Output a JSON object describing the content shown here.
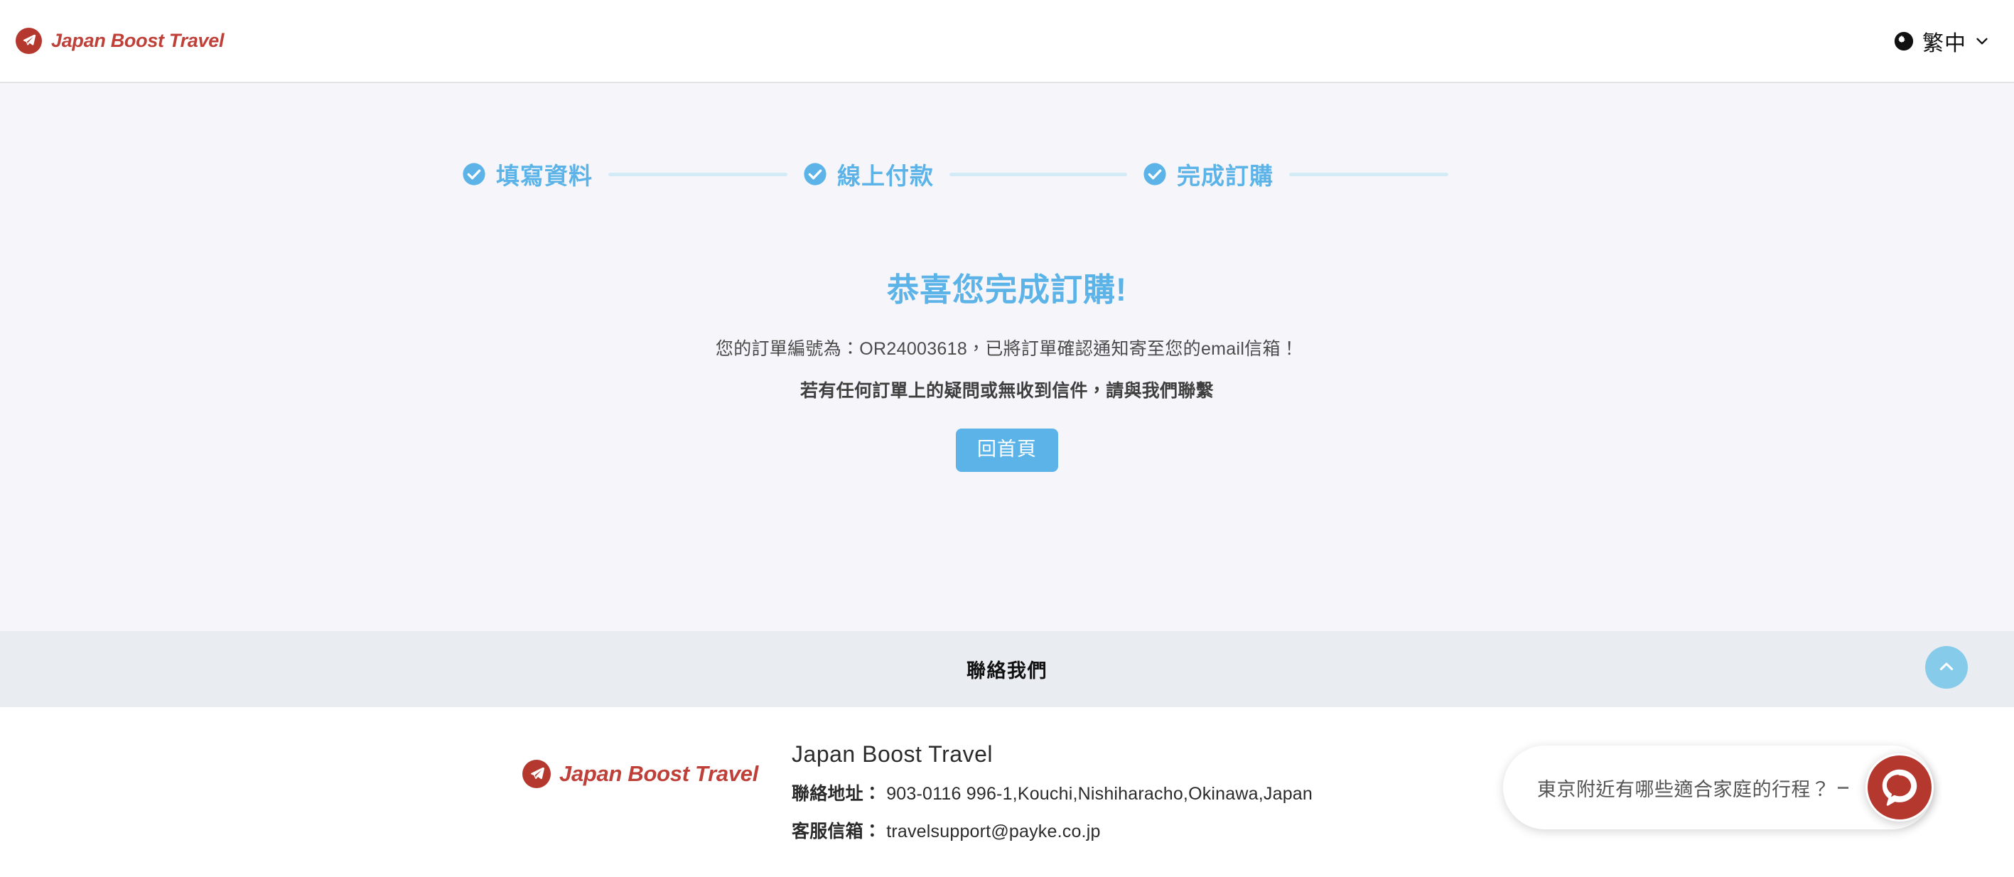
{
  "header": {
    "brand_name": "Japan Boost Travel",
    "brand_icon": "airplane-icon",
    "language": {
      "icon": "globe-icon",
      "label": "繁中",
      "chevron": "chevron-down-icon"
    }
  },
  "stepper": {
    "steps": [
      {
        "label": "填寫資料",
        "icon": "check-circle-icon",
        "completed": true
      },
      {
        "label": "線上付款",
        "icon": "check-circle-icon",
        "completed": true
      },
      {
        "label": "完成訂購",
        "icon": "check-circle-icon",
        "completed": true
      }
    ],
    "line_color": "#d3eaf7",
    "active_color": "#5cb3e8"
  },
  "confirmation": {
    "title": "恭喜您完成訂購!",
    "order_line": "您的訂單編號為：OR24003618，已將訂單確認通知寄至您的email信箱！",
    "order_number": "OR24003618",
    "note": "若有任何訂單上的疑問或無收到信件，請與我們聯繫",
    "home_button": "回首頁"
  },
  "contact_band": {
    "title": "聯絡我們"
  },
  "footer": {
    "brand_name": "Japan Boost Travel",
    "brand_icon": "airplane-icon",
    "company": "Japan Boost Travel",
    "address_label": "聯絡地址：",
    "address_value": "903-0116 996-1,Kouchi,Nishiharacho,Okinawa,Japan",
    "email_label": "客服信箱：",
    "email_value": "travelsupport@payke.co.jp"
  },
  "widgets": {
    "scroll_top_icon": "chevron-up-icon",
    "chat_text": "東京附近有哪些適合家庭的行程？",
    "chat_launcher_icon": "chat-bubble-icon"
  },
  "colors": {
    "brand_red": "#bf4038",
    "accent_blue": "#5cb3e8",
    "page_bg": "#f6f6fa",
    "band_bg": "#e9ecf1",
    "chat_red": "#b5382f"
  }
}
